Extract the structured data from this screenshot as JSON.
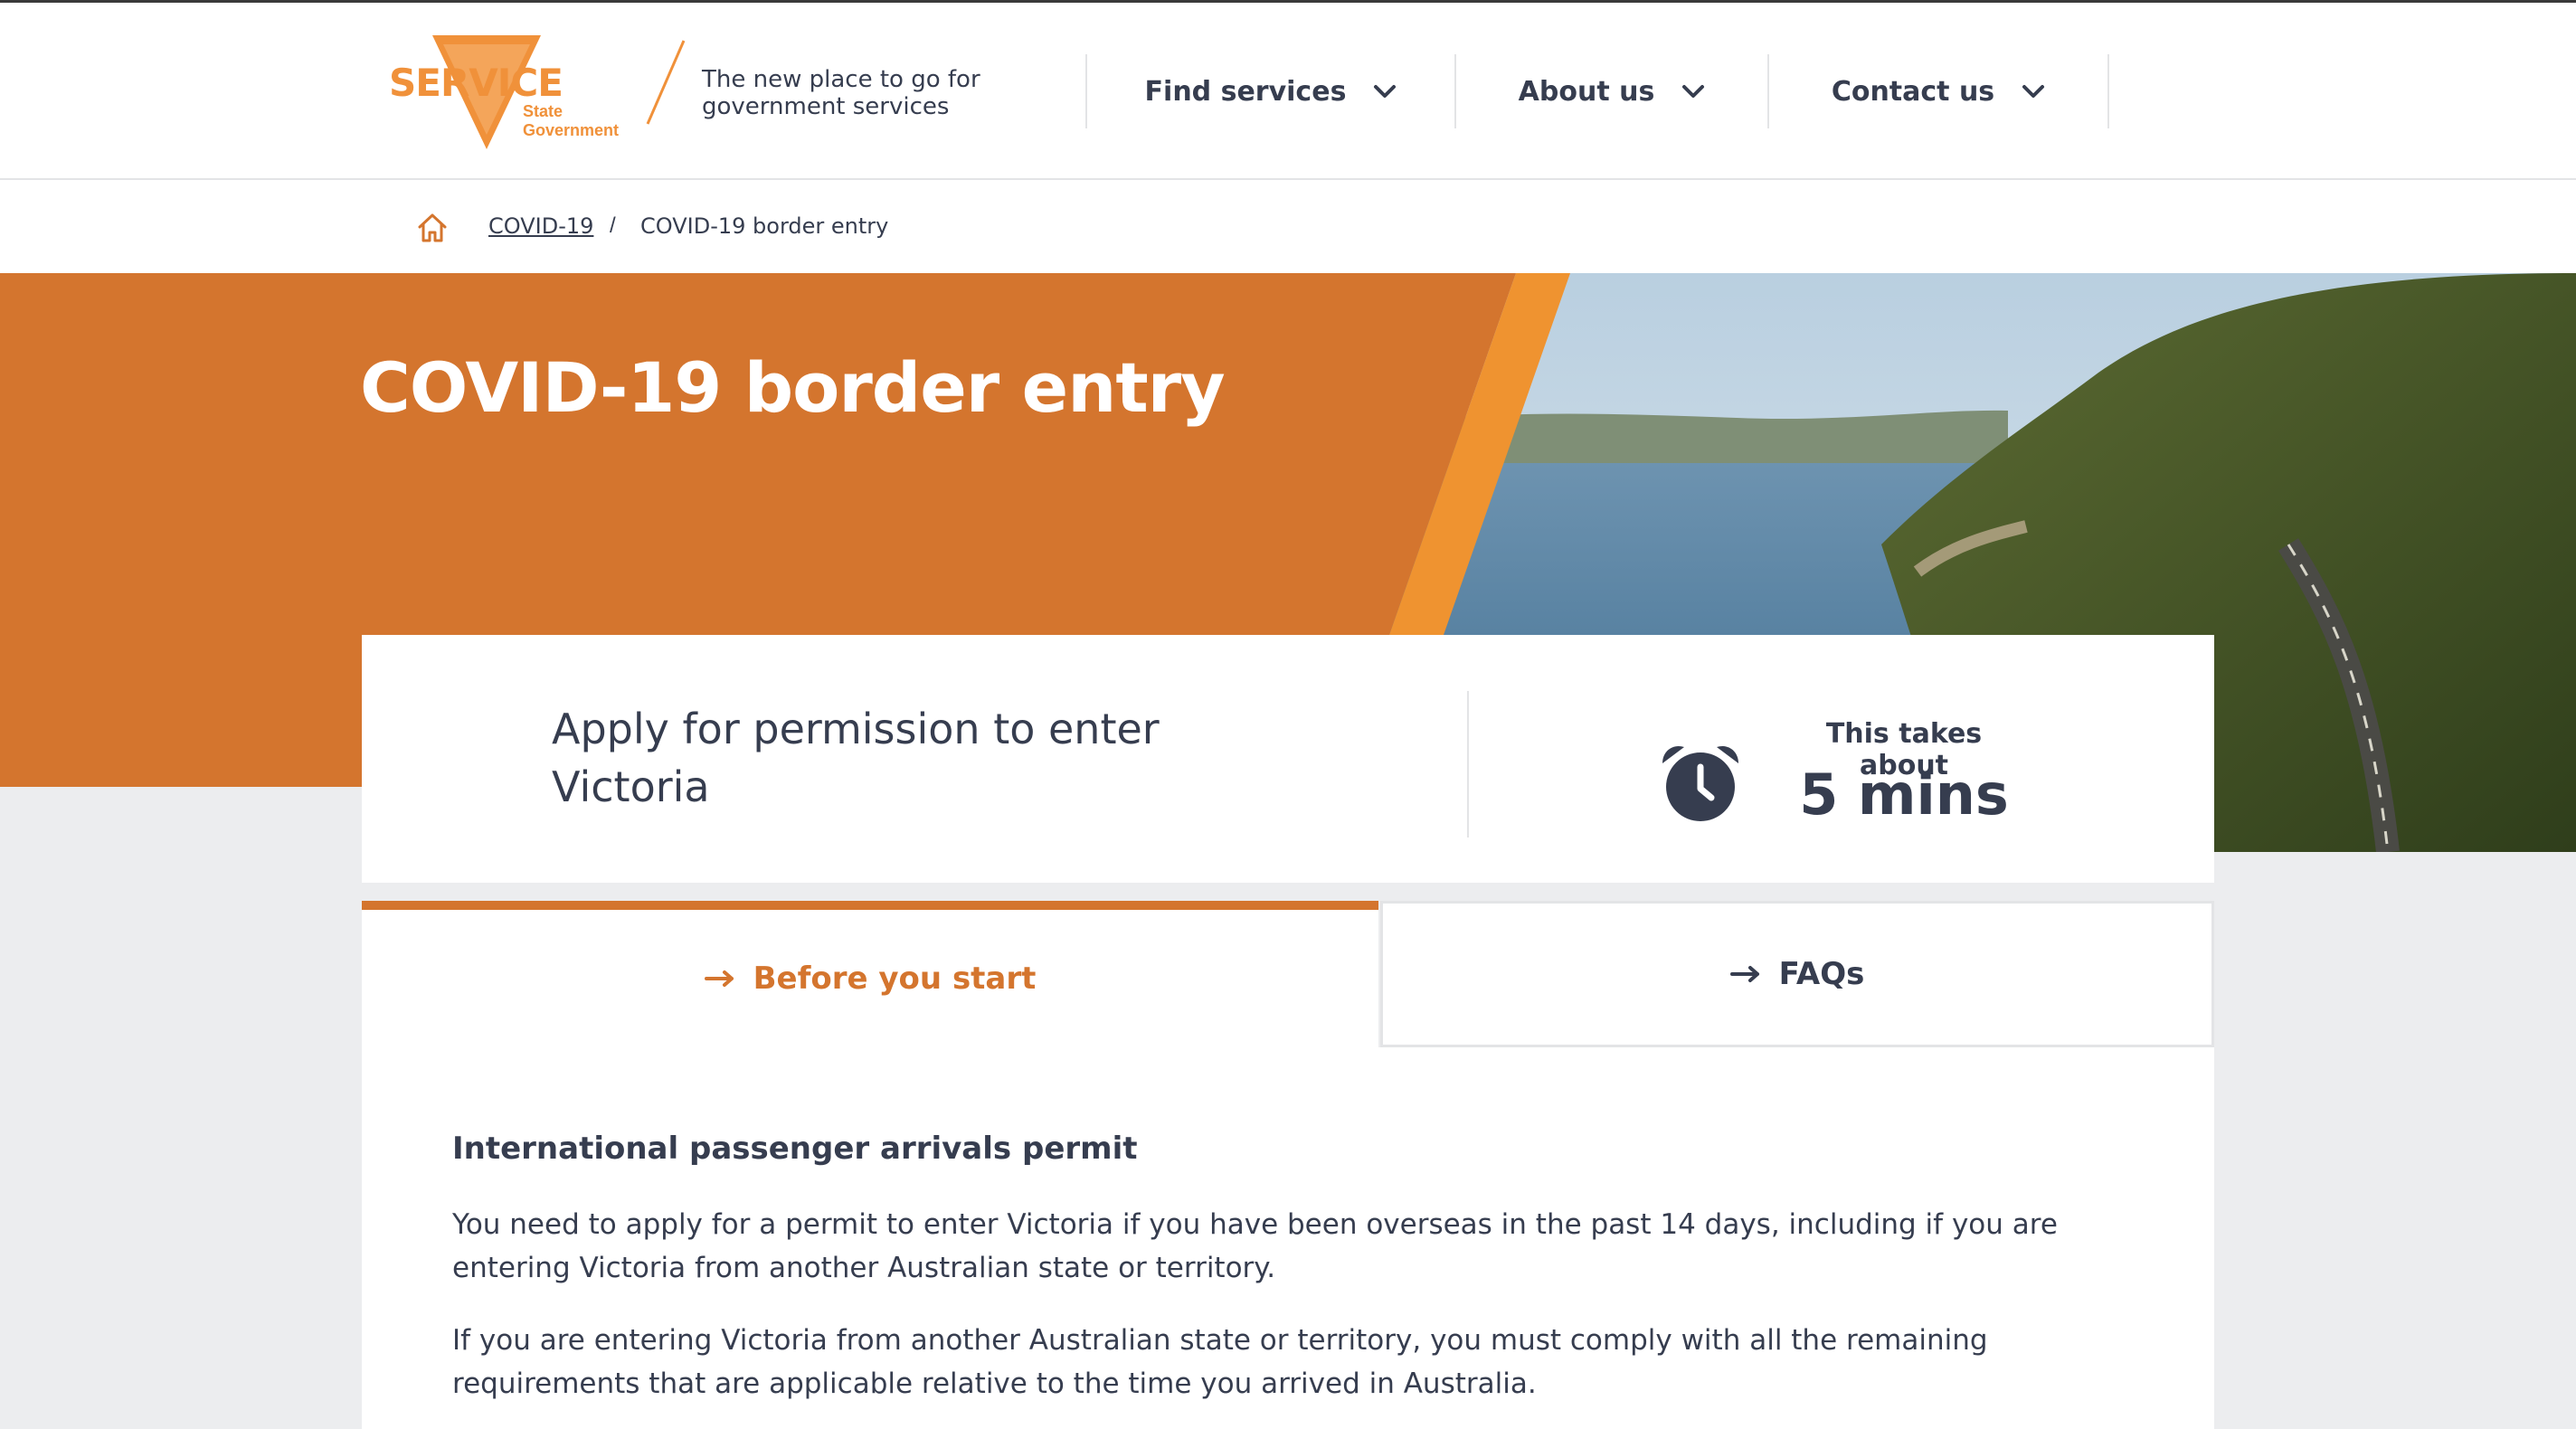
{
  "header": {
    "logo_text": "SERVICE",
    "logo_sub_line1": "State",
    "logo_sub_line2": "Government",
    "tagline": "The new place to go for government services",
    "nav": [
      {
        "label": "Find services"
      },
      {
        "label": "About us"
      },
      {
        "label": "Contact us"
      }
    ]
  },
  "breadcrumb": {
    "link": "COVID-19",
    "separator": "/",
    "current": "COVID-19 border entry"
  },
  "hero": {
    "title": "COVID-19 border entry"
  },
  "info": {
    "lead": "Apply for permission to enter Victoria",
    "takes_label": "This takes about",
    "takes_value": "5 mins"
  },
  "tabs": [
    {
      "label": "Before you start",
      "active": true
    },
    {
      "label": "FAQs",
      "active": false
    }
  ],
  "content": {
    "heading": "International passenger arrivals permit",
    "paragraphs": [
      "You need to apply for a permit to enter Victoria if you have been overseas in the past 14 days, including if you are entering Victoria from another Australian state or territory.",
      "If you are entering Victoria from another Australian state or territory, you must comply with all the remaining requirements that are applicable relative to the time you arrived in Australia."
    ]
  },
  "colors": {
    "brand_orange": "#d4752e",
    "accent_orange": "#f0913a",
    "text": "#363d4f",
    "background": "#ecedef"
  },
  "icons": [
    "victoria-triangle-icon",
    "chevron-down-icon",
    "home-icon",
    "alarm-clock-icon",
    "arrow-right-icon"
  ]
}
